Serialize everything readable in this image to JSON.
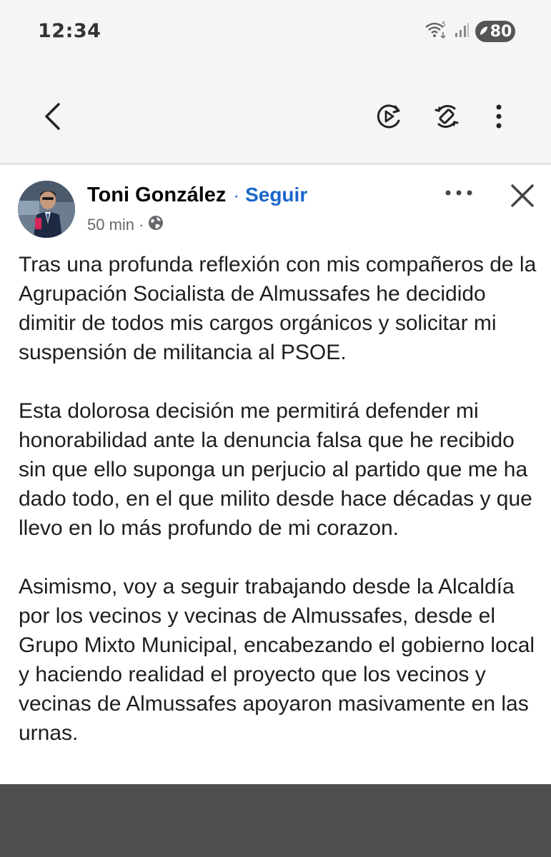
{
  "status_bar": {
    "time": "12:34",
    "battery": "80",
    "network_label": "5"
  },
  "toolbar": {
    "back_icon": "chevron-left-icon",
    "playback_icon": "play-circle-icon",
    "rotate_icon": "rotate-screen-icon",
    "menu_icon": "more-vertical-icon"
  },
  "post": {
    "author": "Toni González",
    "separator": "·",
    "follow_label": "Seguir",
    "time_ago": "50 min",
    "meta_separator": "·",
    "privacy_icon": "globe-icon",
    "paragraphs": [
      "Tras una profunda reflexión con mis compañeros de la Agrupación Socialista de Almussafes he decidido dimitir de todos mis cargos orgánicos y solicitar mi suspensión de militancia al PSOE.",
      "Esta dolorosa decisión me permitirá defender mi honorabilidad ante la denuncia falsa que he recibido sin que ello suponga un perjucio al partido que me ha dado todo, en el que milito desde hace décadas y que llevo en lo más profundo de mi corazon.",
      "Asimismo, voy a seguir trabajando desde la Alcaldía por los vecinos y vecinas de Almussafes, desde el Grupo Mixto Municipal, encabezando el gobierno local y haciendo realidad el proyecto que los vecinos y vecinas de Almussafes apoyaron masivamente en las urnas."
    ]
  },
  "colors": {
    "accent": "#1a66c9",
    "text": "#1c1e21",
    "muted": "#65676b",
    "chrome": "#f5f5f5",
    "bottom_bar": "#4e4e4e"
  }
}
